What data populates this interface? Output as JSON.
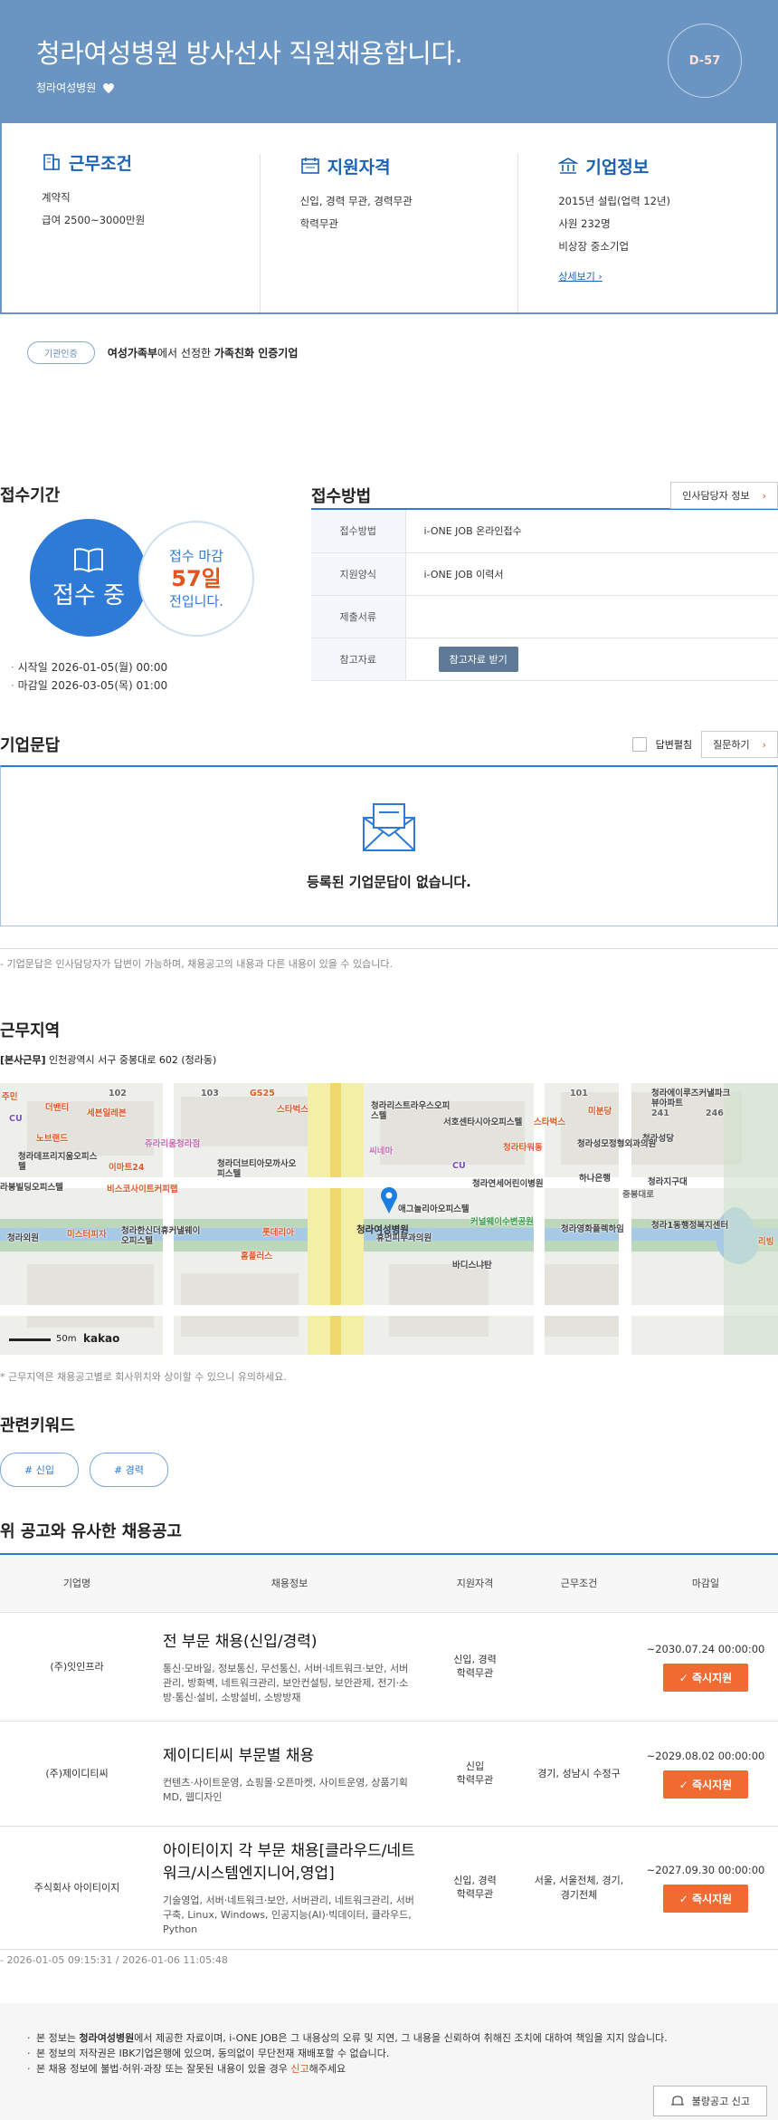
{
  "hero": {
    "title": "청라여성병원 방사선사 직원채용합니다.",
    "company": "청라여성병원",
    "dday": "D-57",
    "bg_color": "#6a94c2"
  },
  "summary": {
    "conditions": {
      "title": "근무조건",
      "icon": "building-icon",
      "lines": [
        "계약직",
        "급여 2500~3000만원"
      ]
    },
    "qualification": {
      "title": "지원자격",
      "icon": "calendar-icon",
      "lines": [
        "신입, 경력 무관, 경력무관",
        "학력무관"
      ]
    },
    "company_info": {
      "title": "기업정보",
      "icon": "bank-icon",
      "lines": [
        "2015년 설립(업력 12년)",
        "사원 232명",
        "비상장 중소기업"
      ],
      "link": "상세보기"
    }
  },
  "cert": {
    "badge": "기관인증",
    "text_pre": "여성가족부",
    "text_mid": "에서 선정한 ",
    "text_bold": "가족친화 인증기업"
  },
  "receipt": {
    "period_title": "접수기간",
    "status": "접수 중",
    "deadline_label": "접수 마감",
    "deadline_days": "57일",
    "deadline_suffix": "전입니다.",
    "start": "시작일 2026-01-05(월) 00:00",
    "end": "마감일 2026-03-05(목) 01:00",
    "method_title": "접수방법",
    "hr_button": "인사담당자 정보",
    "rows": [
      {
        "label": "접수방법",
        "value": "i-ONE JOB 온라인접수"
      },
      {
        "label": "지원양식",
        "value": "i-ONE JOB 이력서"
      },
      {
        "label": "제출서류",
        "value": ""
      },
      {
        "label": "참고자료",
        "value": ""
      }
    ],
    "ref_button": "참고자료 받기"
  },
  "qa": {
    "title": "기업문답",
    "answered_label": "답변펼침",
    "ask_button": "질문하기",
    "empty": "등록된 기업문답이 없습니다.",
    "note": "- 기업문답은 인사담당자가 답변이 가능하며, 채용공고의 내용과 다른 내용이 있을 수 있습니다."
  },
  "location": {
    "title": "근무지역",
    "addr_label": "[본사근무]",
    "address": "인천광역시 서구 중봉대로 602 (청라동)",
    "note": "* 근무지역은 채용공고별로 회사위치와 상이할 수 있으니 유의하세요.",
    "map": {
      "pin_label": "청라여성병원",
      "scale": "50m",
      "brand": "kakao",
      "labels": [
        {
          "t": "주민",
          "c": "#e05a2a"
        },
        {
          "t": "CU",
          "c": "#7b4fb8"
        },
        {
          "t": "더밴티",
          "c": "#e05a2a"
        },
        {
          "t": "세븐일레븐",
          "c": "#e05a2a"
        },
        {
          "t": "노브랜드",
          "c": "#e05a2a"
        },
        {
          "t": "102",
          "c": "#666"
        },
        {
          "t": "103",
          "c": "#666"
        },
        {
          "t": "GS25",
          "c": "#e05a2a"
        },
        {
          "t": "스타벅스",
          "c": "#e05a2a"
        },
        {
          "t": "쥬라리움청라점",
          "c": "#c86ab0"
        },
        {
          "t": "청라더브티아모까사오피스텔",
          "c": "#444"
        },
        {
          "t": "청라데프리지움오피스텔",
          "c": "#444"
        },
        {
          "t": "이마트24",
          "c": "#e05a2a"
        },
        {
          "t": "라봉빌딩오피스텔",
          "c": "#444"
        },
        {
          "t": "비스코사이트커피랩",
          "c": "#e05a2a"
        },
        {
          "t": "청라리스트라우스오피스텔",
          "c": "#444"
        },
        {
          "t": "서호센타시아오피스텔",
          "c": "#444"
        },
        {
          "t": "스타벅스",
          "c": "#e05a2a"
        },
        {
          "t": "미분당",
          "c": "#e05a2a"
        },
        {
          "t": "101",
          "c": "#666"
        },
        {
          "t": "청라에이루즈커낼파크뷰아파트",
          "c": "#444"
        },
        {
          "t": "241",
          "c": "#666"
        },
        {
          "t": "246",
          "c": "#666"
        },
        {
          "t": "청라성당",
          "c": "#444"
        },
        {
          "t": "청라타워동",
          "c": "#e05a2a"
        },
        {
          "t": "청라성모정형외과의원",
          "c": "#444"
        },
        {
          "t": "CU",
          "c": "#7b4fb8"
        },
        {
          "t": "하나은행",
          "c": "#444"
        },
        {
          "t": "청라지구대",
          "c": "#444"
        },
        {
          "t": "청라연세어린이병원",
          "c": "#444"
        },
        {
          "t": "애그놀리아오피스텔",
          "c": "#444"
        },
        {
          "t": "청라외원",
          "c": "#444"
        },
        {
          "t": "미스터피자",
          "c": "#e05a2a"
        },
        {
          "t": "청라한신더휴커낼웨이오피스텔",
          "c": "#444"
        },
        {
          "t": "롯데리아",
          "c": "#e05a2a"
        },
        {
          "t": "홈플러스",
          "c": "#e05a2a"
        },
        {
          "t": "휴먼피부과의원",
          "c": "#444"
        },
        {
          "t": "커널웨이수변공원",
          "c": "#3a9a4a"
        },
        {
          "t": "청라영화플렉하임",
          "c": "#444"
        },
        {
          "t": "청라1동행정복지센터",
          "c": "#444"
        },
        {
          "t": "리빙",
          "c": "#e05a2a"
        },
        {
          "t": "바디스냐탄",
          "c": "#444"
        },
        {
          "t": "중봉대로",
          "c": "#666"
        },
        {
          "t": "씨네마",
          "c": "#c86ab0"
        }
      ]
    }
  },
  "keywords": {
    "title": "관련키워드",
    "tags": [
      "# 신입",
      "# 경력"
    ]
  },
  "similar": {
    "title": "위 공고와 유사한 채용공고",
    "headers": [
      "기업명",
      "채용정보",
      "지원자격",
      "근무조건",
      "마감일"
    ],
    "apply_label": "즉시지원",
    "rows": [
      {
        "company": "(주)잇인프라",
        "title": "전 부문 채용(신입/경력)",
        "desc": "통신·모바일, 정보통신, 무선통신, 서버·네트워크·보안, 서버관리, 방화벽, 네트워크관리, 보안컨설팅, 보안관제, 전기·소방·통신·설비, 소방설비, 소방방재",
        "qual": "신입, 경력\n학력무관",
        "cond": "",
        "deadline": "~2030.07.24 00:00:00"
      },
      {
        "company": "(주)제이디티씨",
        "title": "제이디티씨 부문별 채용",
        "desc": "컨텐츠·사이트운영, 쇼핑몰·오픈마켓, 사이트운영, 상품기획MD, 웹디자인",
        "qual": "신입\n학력무관",
        "cond": "경기, 성남시 수정구",
        "deadline": "~2029.08.02 00:00:00"
      },
      {
        "company": "주식회사 아이티이지",
        "title": "아이티이지 각 부문 채용[클라우드/네트워크/시스템엔지니어,영업]",
        "desc": "기술영업, 서버·네트워크·보안, 서버관리, 네트워크관리, 서버구축, Linux, Windows, 인공지능(AI)·빅데이터, 클라우드, Python",
        "qual": "신입, 경력\n학력무관",
        "cond": "서울, 서울전체, 경기, 경기전체",
        "deadline": "~2027.09.30 00:00:00"
      }
    ]
  },
  "stamp": "- 2026-01-05 09:15:31 / 2026-01-06 11:05:48",
  "footer": {
    "lines": [
      {
        "pre": "본 정보는 ",
        "bold": "청라여성병원",
        "post": "에서 제공한 자료이며, i-ONE JOB은 그 내용상의 오류 및 지연, 그 내용을 신뢰하여 취해진 조치에 대하여 책임을 지지 않습니다."
      },
      {
        "pre": "본 정보의 저작권은 IBK기업은행에 있으며, 동의없이 무단전재 재배포할 수 없습니다.",
        "bold": "",
        "post": ""
      },
      {
        "pre": "본 채용 정보에 불법·허위·과장 또는 잘못된 내용이 있을 경우 ",
        "bold": "신고",
        "post": "해주세요"
      }
    ],
    "report_button": "불량공고 신고"
  }
}
